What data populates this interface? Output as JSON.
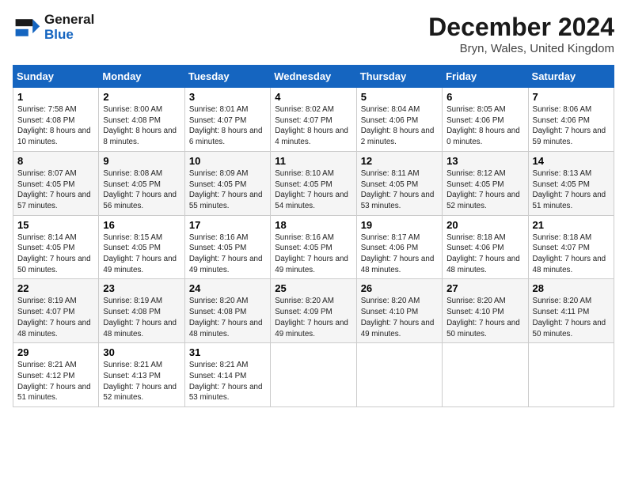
{
  "header": {
    "logo_line1": "General",
    "logo_line2": "Blue",
    "month_title": "December 2024",
    "location": "Bryn, Wales, United Kingdom"
  },
  "weekdays": [
    "Sunday",
    "Monday",
    "Tuesday",
    "Wednesday",
    "Thursday",
    "Friday",
    "Saturday"
  ],
  "weeks": [
    [
      {
        "day": "1",
        "sunrise": "Sunrise: 7:58 AM",
        "sunset": "Sunset: 4:08 PM",
        "daylight": "Daylight: 8 hours and 10 minutes."
      },
      {
        "day": "2",
        "sunrise": "Sunrise: 8:00 AM",
        "sunset": "Sunset: 4:08 PM",
        "daylight": "Daylight: 8 hours and 8 minutes."
      },
      {
        "day": "3",
        "sunrise": "Sunrise: 8:01 AM",
        "sunset": "Sunset: 4:07 PM",
        "daylight": "Daylight: 8 hours and 6 minutes."
      },
      {
        "day": "4",
        "sunrise": "Sunrise: 8:02 AM",
        "sunset": "Sunset: 4:07 PM",
        "daylight": "Daylight: 8 hours and 4 minutes."
      },
      {
        "day": "5",
        "sunrise": "Sunrise: 8:04 AM",
        "sunset": "Sunset: 4:06 PM",
        "daylight": "Daylight: 8 hours and 2 minutes."
      },
      {
        "day": "6",
        "sunrise": "Sunrise: 8:05 AM",
        "sunset": "Sunset: 4:06 PM",
        "daylight": "Daylight: 8 hours and 0 minutes."
      },
      {
        "day": "7",
        "sunrise": "Sunrise: 8:06 AM",
        "sunset": "Sunset: 4:06 PM",
        "daylight": "Daylight: 7 hours and 59 minutes."
      }
    ],
    [
      {
        "day": "8",
        "sunrise": "Sunrise: 8:07 AM",
        "sunset": "Sunset: 4:05 PM",
        "daylight": "Daylight: 7 hours and 57 minutes."
      },
      {
        "day": "9",
        "sunrise": "Sunrise: 8:08 AM",
        "sunset": "Sunset: 4:05 PM",
        "daylight": "Daylight: 7 hours and 56 minutes."
      },
      {
        "day": "10",
        "sunrise": "Sunrise: 8:09 AM",
        "sunset": "Sunset: 4:05 PM",
        "daylight": "Daylight: 7 hours and 55 minutes."
      },
      {
        "day": "11",
        "sunrise": "Sunrise: 8:10 AM",
        "sunset": "Sunset: 4:05 PM",
        "daylight": "Daylight: 7 hours and 54 minutes."
      },
      {
        "day": "12",
        "sunrise": "Sunrise: 8:11 AM",
        "sunset": "Sunset: 4:05 PM",
        "daylight": "Daylight: 7 hours and 53 minutes."
      },
      {
        "day": "13",
        "sunrise": "Sunrise: 8:12 AM",
        "sunset": "Sunset: 4:05 PM",
        "daylight": "Daylight: 7 hours and 52 minutes."
      },
      {
        "day": "14",
        "sunrise": "Sunrise: 8:13 AM",
        "sunset": "Sunset: 4:05 PM",
        "daylight": "Daylight: 7 hours and 51 minutes."
      }
    ],
    [
      {
        "day": "15",
        "sunrise": "Sunrise: 8:14 AM",
        "sunset": "Sunset: 4:05 PM",
        "daylight": "Daylight: 7 hours and 50 minutes."
      },
      {
        "day": "16",
        "sunrise": "Sunrise: 8:15 AM",
        "sunset": "Sunset: 4:05 PM",
        "daylight": "Daylight: 7 hours and 49 minutes."
      },
      {
        "day": "17",
        "sunrise": "Sunrise: 8:16 AM",
        "sunset": "Sunset: 4:05 PM",
        "daylight": "Daylight: 7 hours and 49 minutes."
      },
      {
        "day": "18",
        "sunrise": "Sunrise: 8:16 AM",
        "sunset": "Sunset: 4:05 PM",
        "daylight": "Daylight: 7 hours and 49 minutes."
      },
      {
        "day": "19",
        "sunrise": "Sunrise: 8:17 AM",
        "sunset": "Sunset: 4:06 PM",
        "daylight": "Daylight: 7 hours and 48 minutes."
      },
      {
        "day": "20",
        "sunrise": "Sunrise: 8:18 AM",
        "sunset": "Sunset: 4:06 PM",
        "daylight": "Daylight: 7 hours and 48 minutes."
      },
      {
        "day": "21",
        "sunrise": "Sunrise: 8:18 AM",
        "sunset": "Sunset: 4:07 PM",
        "daylight": "Daylight: 7 hours and 48 minutes."
      }
    ],
    [
      {
        "day": "22",
        "sunrise": "Sunrise: 8:19 AM",
        "sunset": "Sunset: 4:07 PM",
        "daylight": "Daylight: 7 hours and 48 minutes."
      },
      {
        "day": "23",
        "sunrise": "Sunrise: 8:19 AM",
        "sunset": "Sunset: 4:08 PM",
        "daylight": "Daylight: 7 hours and 48 minutes."
      },
      {
        "day": "24",
        "sunrise": "Sunrise: 8:20 AM",
        "sunset": "Sunset: 4:08 PM",
        "daylight": "Daylight: 7 hours and 48 minutes."
      },
      {
        "day": "25",
        "sunrise": "Sunrise: 8:20 AM",
        "sunset": "Sunset: 4:09 PM",
        "daylight": "Daylight: 7 hours and 49 minutes."
      },
      {
        "day": "26",
        "sunrise": "Sunrise: 8:20 AM",
        "sunset": "Sunset: 4:10 PM",
        "daylight": "Daylight: 7 hours and 49 minutes."
      },
      {
        "day": "27",
        "sunrise": "Sunrise: 8:20 AM",
        "sunset": "Sunset: 4:10 PM",
        "daylight": "Daylight: 7 hours and 50 minutes."
      },
      {
        "day": "28",
        "sunrise": "Sunrise: 8:20 AM",
        "sunset": "Sunset: 4:11 PM",
        "daylight": "Daylight: 7 hours and 50 minutes."
      }
    ],
    [
      {
        "day": "29",
        "sunrise": "Sunrise: 8:21 AM",
        "sunset": "Sunset: 4:12 PM",
        "daylight": "Daylight: 7 hours and 51 minutes."
      },
      {
        "day": "30",
        "sunrise": "Sunrise: 8:21 AM",
        "sunset": "Sunset: 4:13 PM",
        "daylight": "Daylight: 7 hours and 52 minutes."
      },
      {
        "day": "31",
        "sunrise": "Sunrise: 8:21 AM",
        "sunset": "Sunset: 4:14 PM",
        "daylight": "Daylight: 7 hours and 53 minutes."
      },
      null,
      null,
      null,
      null
    ]
  ]
}
